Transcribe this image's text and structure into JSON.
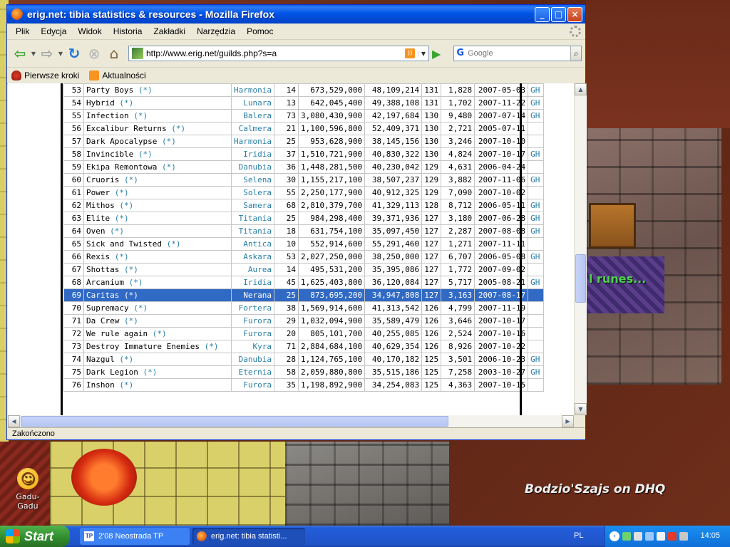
{
  "window": {
    "title": "erig.net: tibia statistics & resources - Mozilla Firefox",
    "minimize_label": "_",
    "maximize_label": "□",
    "close_label": "×"
  },
  "menu": [
    "Plik",
    "Edycja",
    "Widok",
    "Historia",
    "Zakładki",
    "Narzędzia",
    "Pomoc"
  ],
  "nav": {
    "url": "http://www.erig.net/guilds.php?s=a",
    "search_placeholder": "Google"
  },
  "bookmarks": [
    "Pierwsze kroki",
    "Aktualności"
  ],
  "table": {
    "selected_rank": "69",
    "rows": [
      {
        "rank": "53",
        "name": "Party Boys",
        "world": "Harmonia",
        "members": "14",
        "exp": "673,529,000",
        "avg": "48,109,214",
        "lvl": "131",
        "lvl2": "1,828",
        "date": "2007-05-03",
        "gh": "GH"
      },
      {
        "rank": "54",
        "name": "Hybrid",
        "world": "Lunara",
        "members": "13",
        "exp": "642,045,400",
        "avg": "49,388,108",
        "lvl": "131",
        "lvl2": "1,702",
        "date": "2007-11-22",
        "gh": "GH"
      },
      {
        "rank": "55",
        "name": "Infection",
        "world": "Balera",
        "members": "73",
        "exp": "3,080,430,900",
        "avg": "42,197,684",
        "lvl": "130",
        "lvl2": "9,480",
        "date": "2007-07-14",
        "gh": "GH"
      },
      {
        "rank": "56",
        "name": "Excalibur Returns",
        "world": "Calmera",
        "members": "21",
        "exp": "1,100,596,800",
        "avg": "52,409,371",
        "lvl": "130",
        "lvl2": "2,721",
        "date": "2005-07-11",
        "gh": ""
      },
      {
        "rank": "57",
        "name": "Dark Apocalypse",
        "world": "Harmonia",
        "members": "25",
        "exp": "953,628,900",
        "avg": "38,145,156",
        "lvl": "130",
        "lvl2": "3,246",
        "date": "2007-10-10",
        "gh": ""
      },
      {
        "rank": "58",
        "name": "Invincible",
        "world": "Iridia",
        "members": "37",
        "exp": "1,510,721,900",
        "avg": "40,830,322",
        "lvl": "130",
        "lvl2": "4,824",
        "date": "2007-10-17",
        "gh": "GH"
      },
      {
        "rank": "59",
        "name": "Ekipa Remontowa",
        "world": "Danubia",
        "members": "36",
        "exp": "1,448,281,500",
        "avg": "40,230,042",
        "lvl": "129",
        "lvl2": "4,631",
        "date": "2006-04-24",
        "gh": ""
      },
      {
        "rank": "60",
        "name": "Cruoris",
        "world": "Selena",
        "members": "30",
        "exp": "1,155,217,100",
        "avg": "38,507,237",
        "lvl": "129",
        "lvl2": "3,882",
        "date": "2007-11-06",
        "gh": "GH"
      },
      {
        "rank": "61",
        "name": "Power",
        "world": "Solera",
        "members": "55",
        "exp": "2,250,177,900",
        "avg": "40,912,325",
        "lvl": "129",
        "lvl2": "7,090",
        "date": "2007-10-02",
        "gh": ""
      },
      {
        "rank": "62",
        "name": "Mithos",
        "world": "Samera",
        "members": "68",
        "exp": "2,810,379,700",
        "avg": "41,329,113",
        "lvl": "128",
        "lvl2": "8,712",
        "date": "2006-05-11",
        "gh": "GH"
      },
      {
        "rank": "63",
        "name": "Elite",
        "world": "Titania",
        "members": "25",
        "exp": "984,298,400",
        "avg": "39,371,936",
        "lvl": "127",
        "lvl2": "3,180",
        "date": "2007-06-28",
        "gh": "GH"
      },
      {
        "rank": "64",
        "name": "Oven",
        "world": "Titania",
        "members": "18",
        "exp": "631,754,100",
        "avg": "35,097,450",
        "lvl": "127",
        "lvl2": "2,287",
        "date": "2007-08-08",
        "gh": "GH"
      },
      {
        "rank": "65",
        "name": "Sick and Twisted",
        "world": "Antica",
        "members": "10",
        "exp": "552,914,600",
        "avg": "55,291,460",
        "lvl": "127",
        "lvl2": "1,271",
        "date": "2007-11-11",
        "gh": ""
      },
      {
        "rank": "66",
        "name": "Rexis",
        "world": "Askara",
        "members": "53",
        "exp": "2,027,250,000",
        "avg": "38,250,000",
        "lvl": "127",
        "lvl2": "6,707",
        "date": "2006-05-08",
        "gh": "GH"
      },
      {
        "rank": "67",
        "name": "Shottas",
        "world": "Aurea",
        "members": "14",
        "exp": "495,531,200",
        "avg": "35,395,086",
        "lvl": "127",
        "lvl2": "1,772",
        "date": "2007-09-02",
        "gh": ""
      },
      {
        "rank": "68",
        "name": "Arcanium",
        "world": "Iridia",
        "members": "45",
        "exp": "1,625,403,800",
        "avg": "36,120,084",
        "lvl": "127",
        "lvl2": "5,717",
        "date": "2005-08-21",
        "gh": "GH"
      },
      {
        "rank": "69",
        "name": "Caritas",
        "world": "Nerana",
        "members": "25",
        "exp": "873,695,200",
        "avg": "34,947,808",
        "lvl": "127",
        "lvl2": "3,163",
        "date": "2007-08-17",
        "gh": ""
      },
      {
        "rank": "70",
        "name": "Supremacy",
        "world": "Fortera",
        "members": "38",
        "exp": "1,569,914,600",
        "avg": "41,313,542",
        "lvl": "126",
        "lvl2": "4,799",
        "date": "2007-11-19",
        "gh": ""
      },
      {
        "rank": "71",
        "name": "Da Crew",
        "world": "Furora",
        "members": "29",
        "exp": "1,032,094,900",
        "avg": "35,589,479",
        "lvl": "126",
        "lvl2": "3,646",
        "date": "2007-10-17",
        "gh": ""
      },
      {
        "rank": "72",
        "name": "We rule again",
        "world": "Furora",
        "members": "20",
        "exp": "805,101,700",
        "avg": "40,255,085",
        "lvl": "126",
        "lvl2": "2,524",
        "date": "2007-10-16",
        "gh": ""
      },
      {
        "rank": "73",
        "name": "Destroy Immature Enemies",
        "world": "Kyra",
        "members": "71",
        "exp": "2,884,684,100",
        "avg": "40,629,354",
        "lvl": "126",
        "lvl2": "8,926",
        "date": "2007-10-22",
        "gh": ""
      },
      {
        "rank": "74",
        "name": "Nazgul",
        "world": "Danubia",
        "members": "28",
        "exp": "1,124,765,100",
        "avg": "40,170,182",
        "lvl": "125",
        "lvl2": "3,501",
        "date": "2006-10-23",
        "gh": "GH"
      },
      {
        "rank": "75",
        "name": "Dark Legion",
        "world": "Eternia",
        "members": "58",
        "exp": "2,059,880,800",
        "avg": "35,515,186",
        "lvl": "125",
        "lvl2": "7,258",
        "date": "2003-10-27",
        "gh": "GH"
      },
      {
        "rank": "76",
        "name": "Inshon",
        "world": "Furora",
        "members": "35",
        "exp": "1,198,892,900",
        "avg": "34,254,083",
        "lvl": "125",
        "lvl2": "4,363",
        "date": "2007-10-15",
        "gh": ""
      }
    ],
    "star_label": "(*)"
  },
  "status": "Zakończono",
  "desktop": {
    "icon_label": "Gadu-Gadu",
    "game_caption": "Bodzio'Szajs on DHQ",
    "runes_text": "l runes..."
  },
  "taskbar": {
    "start_label": "Start",
    "items": [
      "2'08 Neostrada TP",
      "erig.net: tibia statisti..."
    ],
    "lang": "PL",
    "clock": "14:05"
  }
}
